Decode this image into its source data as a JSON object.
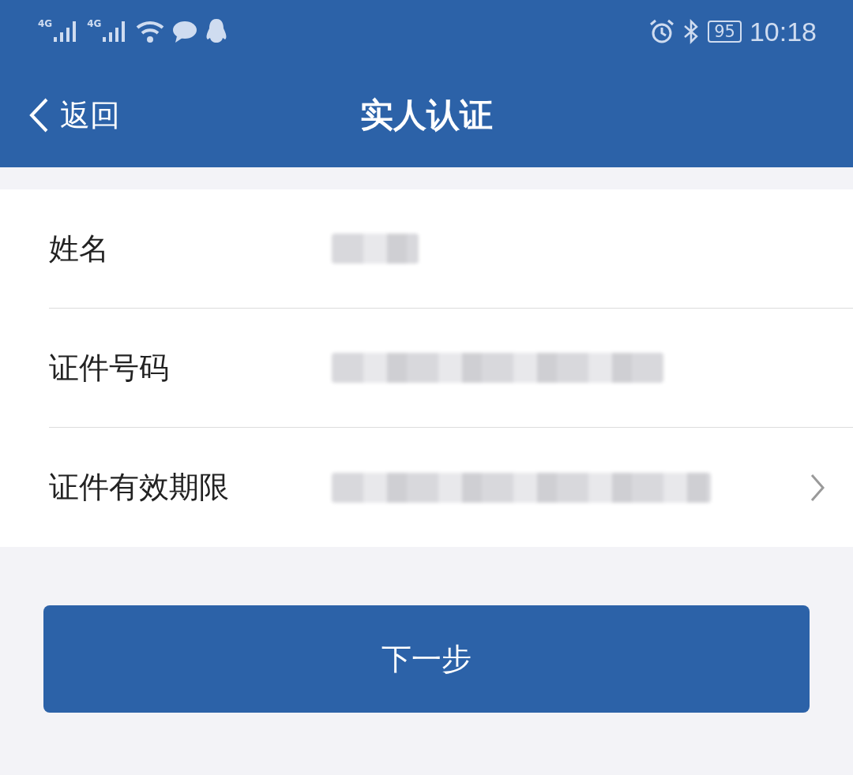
{
  "status_bar": {
    "signals": [
      {
        "label": "4G"
      },
      {
        "label": "4G"
      }
    ],
    "battery": "95",
    "time": "10:18"
  },
  "nav": {
    "back": "返回",
    "title": "实人认证"
  },
  "form": {
    "rows": [
      {
        "label": "姓名",
        "value_blurred": true,
        "chevron": false
      },
      {
        "label": "证件号码",
        "value_blurred": true,
        "chevron": false
      },
      {
        "label": "证件有效期限",
        "value_blurred": true,
        "chevron": true
      }
    ]
  },
  "button": "下一步"
}
